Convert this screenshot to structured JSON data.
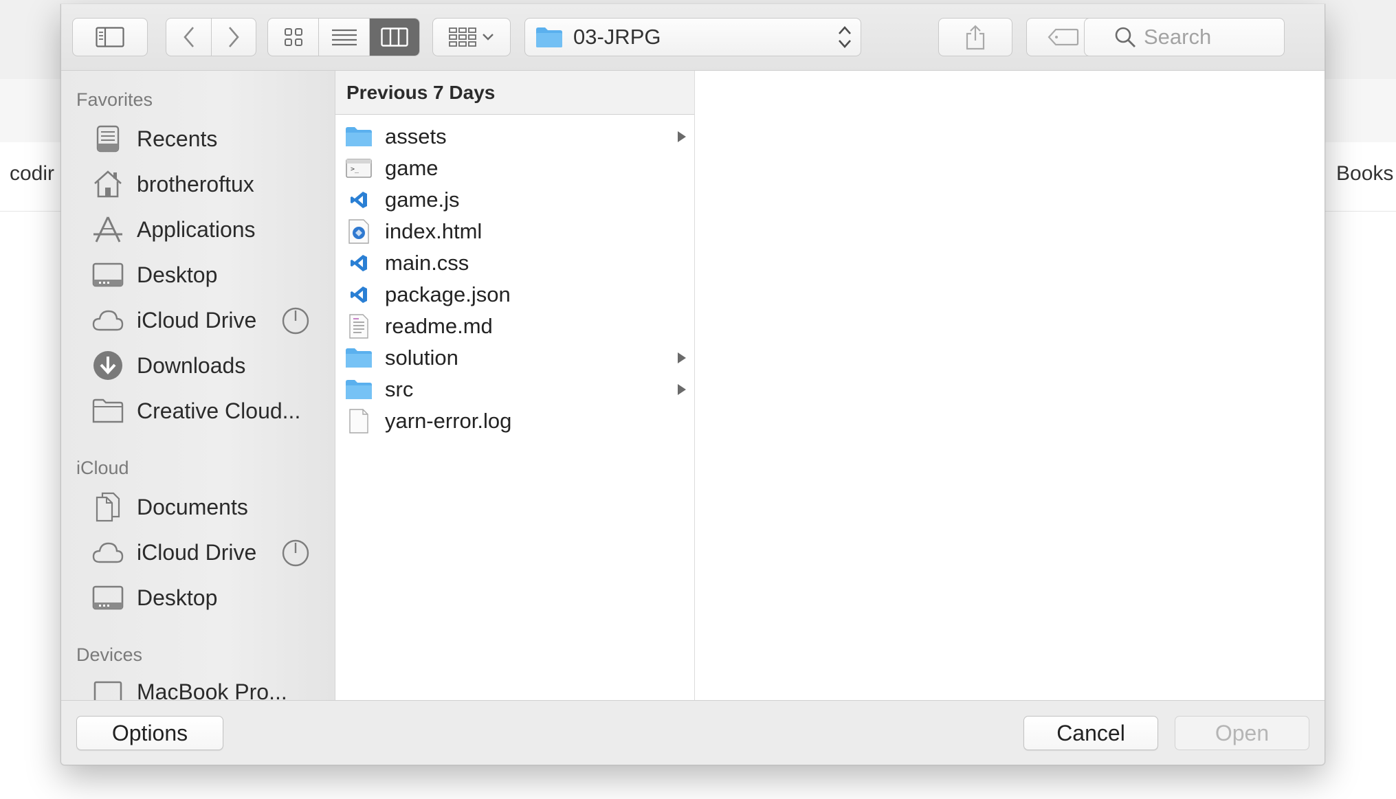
{
  "background_app": {
    "tab_left_fragment": "codir",
    "tab_right_fragment": "Books"
  },
  "toolbar": {
    "path_popup": {
      "folder_name": "03-JRPG",
      "icon": "folder-icon"
    },
    "search": {
      "placeholder": "Search"
    },
    "active_view": "columns"
  },
  "sidebar": {
    "sections": [
      {
        "header": "Favorites",
        "items": [
          {
            "label": "Recents",
            "icon": "recents-icon"
          },
          {
            "label": "brotheroftux",
            "icon": "home-icon"
          },
          {
            "label": "Applications",
            "icon": "applications-icon"
          },
          {
            "label": "Desktop",
            "icon": "desktop-icon"
          },
          {
            "label": "iCloud Drive",
            "icon": "cloud-icon",
            "sync": true
          },
          {
            "label": "Downloads",
            "icon": "downloads-icon"
          },
          {
            "label": "Creative Cloud...",
            "icon": "folder-icon"
          }
        ]
      },
      {
        "header": "iCloud",
        "items": [
          {
            "label": "Documents",
            "icon": "documents-icon"
          },
          {
            "label": "iCloud Drive",
            "icon": "cloud-icon",
            "sync": true
          },
          {
            "label": "Desktop",
            "icon": "desktop-icon"
          }
        ]
      },
      {
        "header": "Devices",
        "items": [
          {
            "label": "MacBook Pro...",
            "icon": "laptop-icon"
          }
        ]
      }
    ]
  },
  "browser": {
    "column_header": "Previous 7 Days",
    "files": [
      {
        "name": "assets",
        "kind": "folder",
        "has_children": true
      },
      {
        "name": "game",
        "kind": "executable",
        "has_children": false
      },
      {
        "name": "game.js",
        "kind": "vscode",
        "has_children": false
      },
      {
        "name": "index.html",
        "kind": "html",
        "has_children": false
      },
      {
        "name": "main.css",
        "kind": "vscode",
        "has_children": false
      },
      {
        "name": "package.json",
        "kind": "vscode",
        "has_children": false
      },
      {
        "name": "readme.md",
        "kind": "text",
        "has_children": false
      },
      {
        "name": "solution",
        "kind": "folder",
        "has_children": true
      },
      {
        "name": "src",
        "kind": "folder",
        "has_children": true
      },
      {
        "name": "yarn-error.log",
        "kind": "blank",
        "has_children": false
      }
    ]
  },
  "footer": {
    "options_label": "Options",
    "cancel_label": "Cancel",
    "open_label": "Open",
    "open_enabled": false
  },
  "colors": {
    "folder_blue": "#5ab0ee",
    "vscode_blue": "#2a7fd4",
    "active_segment": "#6b6b6b"
  }
}
